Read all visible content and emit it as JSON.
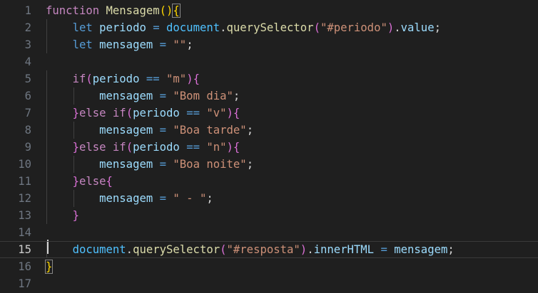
{
  "editor": {
    "language": "javascript",
    "current_line": 15,
    "colors": {
      "background": "#1f1f1f",
      "line_number": "#6e7681",
      "keyword_control": "#c586c0",
      "keyword_declaration": "#569cd6",
      "function_name": "#dcdcaa",
      "variable": "#9cdcfe",
      "string": "#ce9178",
      "bracket_level_1": "#ffd700",
      "bracket_level_2": "#da70d6",
      "bracket_level_3": "#179fff"
    },
    "lines": [
      {
        "number": "1",
        "text": "function Mensagem(){"
      },
      {
        "number": "2",
        "text": "    let periodo = document.querySelector(\"#periodo\").value;"
      },
      {
        "number": "3",
        "text": "    let mensagem = \"\";"
      },
      {
        "number": "4",
        "text": ""
      },
      {
        "number": "5",
        "text": "    if(periodo == \"m\"){"
      },
      {
        "number": "6",
        "text": "        mensagem = \"Bom dia\";"
      },
      {
        "number": "7",
        "text": "    }else if(periodo == \"v\"){"
      },
      {
        "number": "8",
        "text": "        mensagem = \"Boa tarde\";"
      },
      {
        "number": "9",
        "text": "    }else if(periodo == \"n\"){"
      },
      {
        "number": "10",
        "text": "        mensagem = \"Boa noite\";"
      },
      {
        "number": "11",
        "text": "    }else{"
      },
      {
        "number": "12",
        "text": "        mensagem = \" - \";"
      },
      {
        "number": "13",
        "text": "    }"
      },
      {
        "number": "14",
        "text": ""
      },
      {
        "number": "15",
        "text": "    document.querySelector(\"#resposta\").innerHTML = mensagem;"
      },
      {
        "number": "16",
        "text": "}"
      },
      {
        "number": "17",
        "text": ""
      }
    ]
  }
}
